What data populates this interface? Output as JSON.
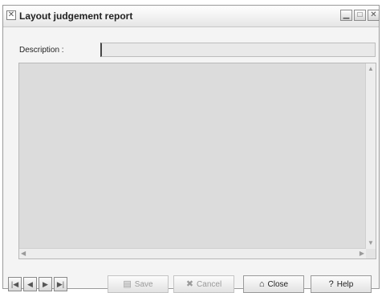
{
  "window": {
    "title": "Layout judgement report",
    "app_icon": "close-x-icon",
    "controls": {
      "minimize_icon": "minimize-icon",
      "maximize_icon": "maximize-icon",
      "close_icon": "close-icon"
    }
  },
  "form": {
    "description_label": "Description :",
    "description_value": "",
    "report_text": ""
  },
  "navigation": {
    "first_icon": "first-record-icon",
    "prev_icon": "previous-record-icon",
    "next_icon": "next-record-icon",
    "last_icon": "last-record-icon"
  },
  "buttons": {
    "save": {
      "label": "Save",
      "icon": "disk-icon",
      "enabled": false
    },
    "cancel": {
      "label": "Cancel",
      "icon": "cancel-x-icon",
      "enabled": false
    },
    "close": {
      "label": "Close",
      "icon": "door-icon",
      "enabled": true
    },
    "help": {
      "label": "Help",
      "icon": "help-book-icon",
      "enabled": true
    }
  },
  "colors": {
    "window_bg": "#f4f4f4",
    "report_bg": "#dcdcdc",
    "input_bg": "#e9e9e9"
  }
}
